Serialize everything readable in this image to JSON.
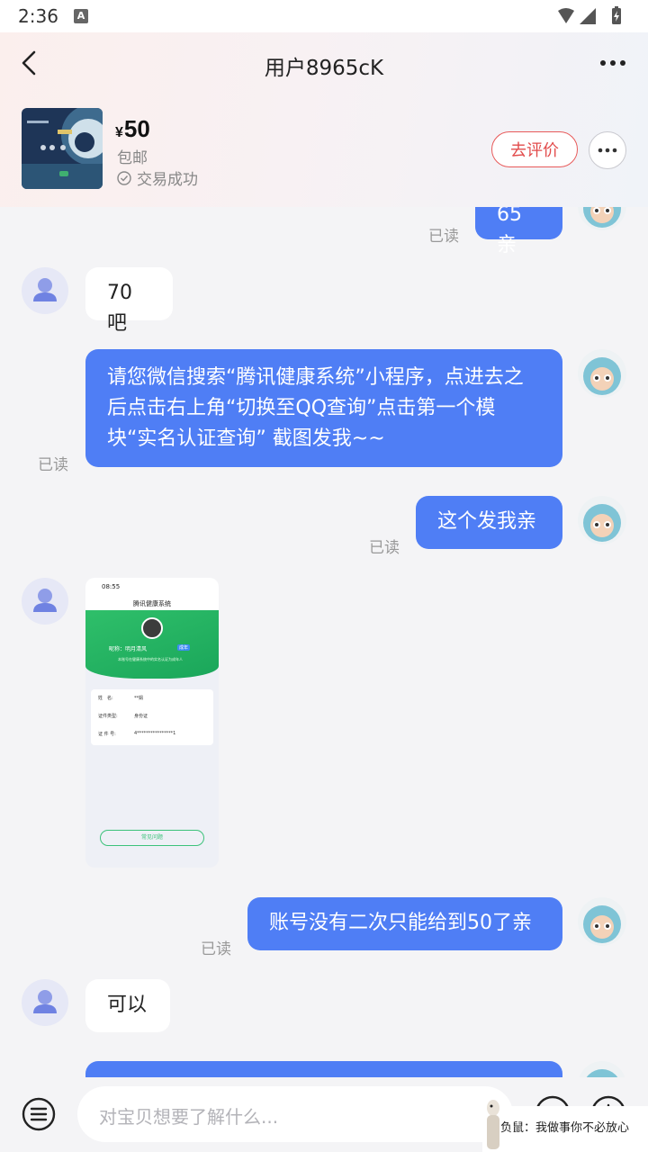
{
  "status_bar": {
    "time": "2:36",
    "notification_icon": "A"
  },
  "header": {
    "title": "用户8965cK"
  },
  "product": {
    "currency": "¥",
    "price": "50",
    "shipping": "包邮",
    "status": "交易成功",
    "review_button": "去评价"
  },
  "messages": {
    "m1": {
      "text": "65亲",
      "read": "已读"
    },
    "m2": {
      "text": "70吧"
    },
    "m3": {
      "text": "请您微信搜索“腾讯健康系统”小程序，点进去之后点击右上角“切换至QQ查询”点击第一个模块“实名认证查询” 截图发我~~",
      "read": "已读"
    },
    "m4": {
      "text": "这个发我亲",
      "read": "已读"
    },
    "m5": {
      "time": "08:55",
      "app_title": "腾讯健康系统",
      "nickname": "昵称：明月清风",
      "tag": "成年",
      "subtitle": "本账号在健康系统中的实名认证为成年人",
      "rows": [
        {
          "label": "姓　名:",
          "value": "**娟"
        },
        {
          "label": "证件类型:",
          "value": "身份证"
        },
        {
          "label": "证 件 号:",
          "value": "4****************1"
        }
      ],
      "faq_button": "常见问题"
    },
    "m6": {
      "text": "账号没有二次只能给到50了亲",
      "read": "已读"
    },
    "m7": {
      "text": "可以"
    }
  },
  "input": {
    "placeholder": "对宝贝想要了解什么..."
  },
  "overlay": {
    "text": "负鼠：我做事你不必放心"
  },
  "colors": {
    "self_bubble": "#4f7ef5",
    "review_border": "#e85a5a",
    "avatar_bg": "#e6e8f6"
  }
}
